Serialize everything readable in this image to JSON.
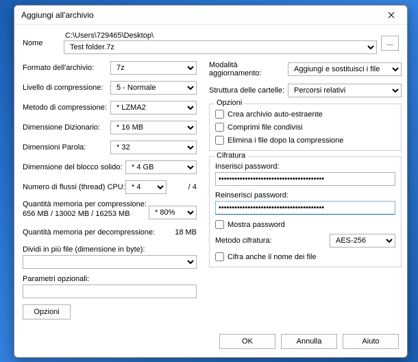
{
  "window": {
    "title": "Aggiungi all'archivio"
  },
  "name": {
    "label": "Nome",
    "path": "C:\\Users\\729465\\Desktop\\",
    "filename": "Test folder.7z",
    "browse": "..."
  },
  "left": {
    "format": {
      "label": "Formato dell'archivio:",
      "value": "7z"
    },
    "level": {
      "label": "Livello di compressione:",
      "value": "5 - Normale"
    },
    "method": {
      "label": "Metodo di compressione:",
      "value": "* LZMA2"
    },
    "dict": {
      "label": "Dimensione Dizionario:",
      "value": "* 16 MB"
    },
    "word": {
      "label": "Dimensioni Parola:",
      "value": "* 32"
    },
    "block": {
      "label": "Dimensione del blocco solido:",
      "value": "* 4 GB"
    },
    "threads": {
      "label": "Numero di flussi (thread) CPU:",
      "value": "* 4",
      "max": "/ 4"
    },
    "mem_comp_label": "Quantità memoria per compressione:",
    "mem_comp_detail": "656 MB / 13002 MB / 16253 MB",
    "mem_comp_sel": "* 80%",
    "mem_decomp_label": "Quantità memoria per decompressione:",
    "mem_decomp_val": "18 MB",
    "split_label": "Dividi in più file (dimensione in byte):",
    "split_value": "",
    "params_label": "Parametri opzionali:",
    "params_value": "",
    "options_btn": "Opzioni"
  },
  "right": {
    "update": {
      "label": "Modalità aggiornamento:",
      "value": "Aggiungi e sostituisci i file"
    },
    "paths": {
      "label": "Struttura delle cartelle:",
      "value": "Percorsi relativi"
    },
    "options_group": "Opzioni",
    "sfx": "Crea archivio auto-estraente",
    "shared": "Comprimi file condivisi",
    "delete_after": "Elimina i file dopo la compressione",
    "enc_group": "Cifratura",
    "pwd1_label": "Inserisci password:",
    "pwd1_value": "••••••••••••••••••••••••••••••••••••••••",
    "pwd2_label": "Reinserisci password:",
    "pwd2_value": "••••••••••••••••••••••••••••••••••••••••",
    "show_pwd": "Mostra password",
    "enc_method_label": "Metodo cifratura:",
    "enc_method_value": "AES-256",
    "enc_names": "Cifra anche il nome dei file"
  },
  "footer": {
    "ok": "OK",
    "cancel": "Annulla",
    "help": "Aiuto"
  }
}
